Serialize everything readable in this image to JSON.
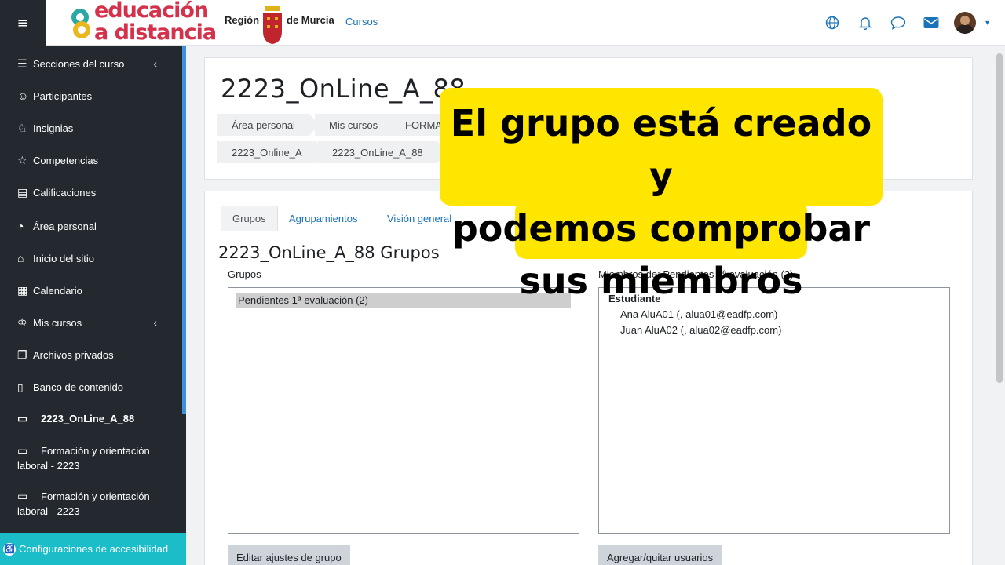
{
  "navbar": {
    "hamburger": "≡",
    "logo_line1": "educación",
    "logo_line2": "a distancia",
    "region_left": "Región",
    "region_right": "de Murcia",
    "nav_link": "Cursos",
    "icons": [
      "globe-icon",
      "bell-icon",
      "chat-icon",
      "mail-icon",
      "avatar",
      "caret-icon"
    ]
  },
  "sidebar": {
    "items": [
      {
        "label": "Secciones del curso",
        "icon": "list-icon",
        "chevron": "‹"
      },
      {
        "label": "Participantes",
        "icon": "users-icon"
      },
      {
        "label": "Insignias",
        "icon": "badge-icon"
      },
      {
        "label": "Competencias",
        "icon": "star-icon"
      },
      {
        "label": "Calificaciones",
        "icon": "table-icon"
      },
      {
        "label": "Área personal",
        "icon": "dashboard-icon"
      },
      {
        "label": "Inicio del sitio",
        "icon": "home-icon"
      },
      {
        "label": "Calendario",
        "icon": "calendar-icon"
      },
      {
        "label": "Mis cursos",
        "icon": "graduation-icon",
        "chevron": "‹"
      },
      {
        "label": "Archivos privados",
        "icon": "files-icon"
      },
      {
        "label": "Banco de contenido",
        "icon": "clipboard-icon"
      }
    ],
    "courses": [
      {
        "label": "2223_OnLine_A_88"
      },
      {
        "label": "Formación y orientación laboral - 2223"
      },
      {
        "label": "Formación y orientación laboral - 2223"
      }
    ],
    "accessibility": "Configuraciones de accesibilidad"
  },
  "header": {
    "course_title": "2223_OnLine_A_88",
    "breadcrumb_row1": [
      "Área personal",
      "Mis cursos",
      "FORMAC"
    ],
    "breadcrumb_row2": [
      "2223_Online_A",
      "2223_OnLine_A_88"
    ]
  },
  "main": {
    "tabs": [
      "Grupos",
      "Agrupamientos",
      "Visión general"
    ],
    "active_tab": "Grupos",
    "title": "2223_OnLine_A_88 Grupos",
    "groups_label": "Grupos",
    "groups": [
      "Pendientes 1ª evaluación (2)"
    ],
    "members_label": "Miembros de: Pendientes 1ª evaluación (2)",
    "member_role": "Estudiante",
    "members": [
      "Ana AluA01 (, alua01@eadfp.com)",
      "Juan AluA02 (, alua02@eadfp.com)"
    ],
    "edit_button": "Editar ajustes de grupo",
    "addremove_button": "Agregar/quitar usuarios"
  },
  "overlay": {
    "line1": "El grupo está creado y",
    "line2": "podemos comprobar",
    "line3": "sus miembros"
  },
  "colors": {
    "sidebar_bg": "#23292f",
    "link": "#1a73b8",
    "callout": "#ffe600",
    "accessibility": "#1bbdc9"
  }
}
